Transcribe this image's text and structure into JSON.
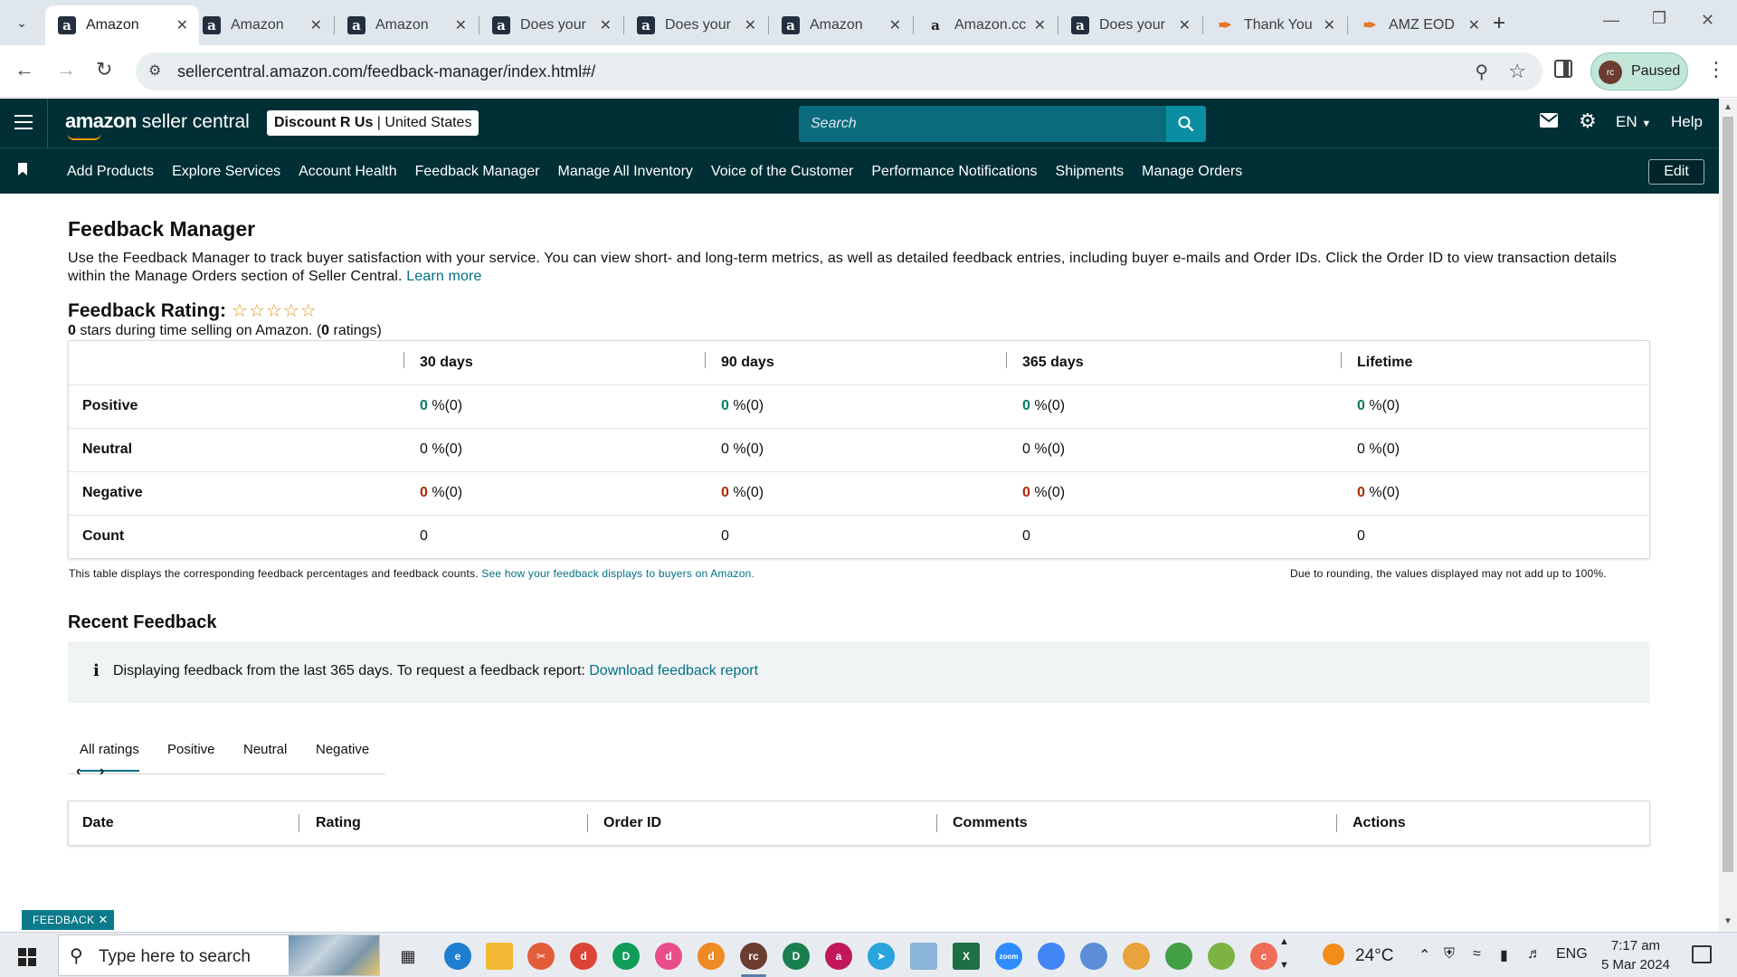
{
  "browser": {
    "tabs": [
      {
        "label": "Amazon",
        "icon": "amazon-a",
        "active": true
      },
      {
        "label": "Amazon",
        "icon": "amazon-a"
      },
      {
        "label": "Amazon",
        "icon": "amazon-a"
      },
      {
        "label": "Does your",
        "icon": "amazon-a"
      },
      {
        "label": "Does your",
        "icon": "amazon-a"
      },
      {
        "label": "Amazon",
        "icon": "amazon-a"
      },
      {
        "label": "Amazon.cc",
        "icon": "amazon-a-plain"
      },
      {
        "label": "Does your",
        "icon": "amazon-a"
      },
      {
        "label": "Thank You",
        "icon": "feather"
      },
      {
        "label": "AMZ EOD",
        "icon": "feather"
      }
    ],
    "url": "sellercentral.amazon.com/feedback-manager/index.html#/",
    "profile_initials": "rc",
    "profile_status": "Paused"
  },
  "header": {
    "logo_part1": "amazon",
    "logo_part2": " seller central",
    "store_name": "Discount R Us",
    "store_region": " | United States",
    "search_placeholder": "Search",
    "language": "EN",
    "help": "Help"
  },
  "nav": {
    "links": [
      "Add Products",
      "Explore Services",
      "Account Health",
      "Feedback Manager",
      "Manage All Inventory",
      "Voice of the Customer",
      "Performance Notifications",
      "Shipments",
      "Manage Orders"
    ],
    "edit_label": "Edit"
  },
  "page": {
    "title": "Feedback Manager",
    "description": "Use the Feedback Manager to track buyer satisfaction with your service. You can view short- and long-term metrics, as well as detailed feedback entries, including buyer e-mails and Order IDs. Click the Order ID to view transaction details within the Manage Orders section of Seller Central.",
    "learn_more": "Learn more",
    "rating_label": "Feedback Rating:",
    "stars_value": "0",
    "stars_text_mid": " stars during time selling on Amazon. (",
    "ratings_count": "0",
    "ratings_text_end": " ratings)"
  },
  "stats_table": {
    "columns": [
      "30 days",
      "90 days",
      "365 days",
      "Lifetime"
    ],
    "rows": [
      {
        "label": "Positive",
        "kind": "pos",
        "cells": [
          {
            "num": "0",
            "rest": " %(0)"
          },
          {
            "num": "0",
            "rest": " %(0)"
          },
          {
            "num": "0",
            "rest": " %(0)"
          },
          {
            "num": "0",
            "rest": " %(0)"
          }
        ]
      },
      {
        "label": "Neutral",
        "kind": "neu",
        "cells": [
          {
            "num": "0",
            "rest": " %(0)"
          },
          {
            "num": "0",
            "rest": " %(0)"
          },
          {
            "num": "0",
            "rest": " %(0)"
          },
          {
            "num": "0",
            "rest": " %(0)"
          }
        ]
      },
      {
        "label": "Negative",
        "kind": "neg",
        "cells": [
          {
            "num": "0",
            "rest": " %(0)"
          },
          {
            "num": "0",
            "rest": " %(0)"
          },
          {
            "num": "0",
            "rest": " %(0)"
          },
          {
            "num": "0",
            "rest": " %(0)"
          }
        ]
      },
      {
        "label": "Count",
        "kind": "cnt",
        "cells": [
          {
            "num": "0",
            "rest": ""
          },
          {
            "num": "0",
            "rest": ""
          },
          {
            "num": "0",
            "rest": ""
          },
          {
            "num": "0",
            "rest": ""
          }
        ]
      }
    ],
    "note": "This table displays the corresponding feedback percentages and feedback counts. ",
    "note_link": "See how your feedback displays to buyers on Amazon.",
    "rounding_note": "Due to rounding, the values displayed may not add up to 100%."
  },
  "recent": {
    "title": "Recent Feedback",
    "info_text": "Displaying feedback from the last 365 days. To request a feedback report: ",
    "info_link": "Download feedback report",
    "tabs": [
      "All ratings",
      "Positive",
      "Neutral",
      "Negative"
    ],
    "columns": [
      "Date",
      "Rating",
      "Order ID",
      "Comments",
      "Actions"
    ]
  },
  "feedback_widget": "FEEDBACK",
  "taskbar": {
    "search_placeholder": "Type here to search",
    "temperature": "24°C",
    "language": "ENG",
    "time": "7:17 am",
    "date": "5 Mar 2024"
  },
  "colors": {
    "header_bg": "#002f36",
    "link": "#007185",
    "positive": "#067d62",
    "negative": "#b12704",
    "star": "#de9a1a"
  }
}
